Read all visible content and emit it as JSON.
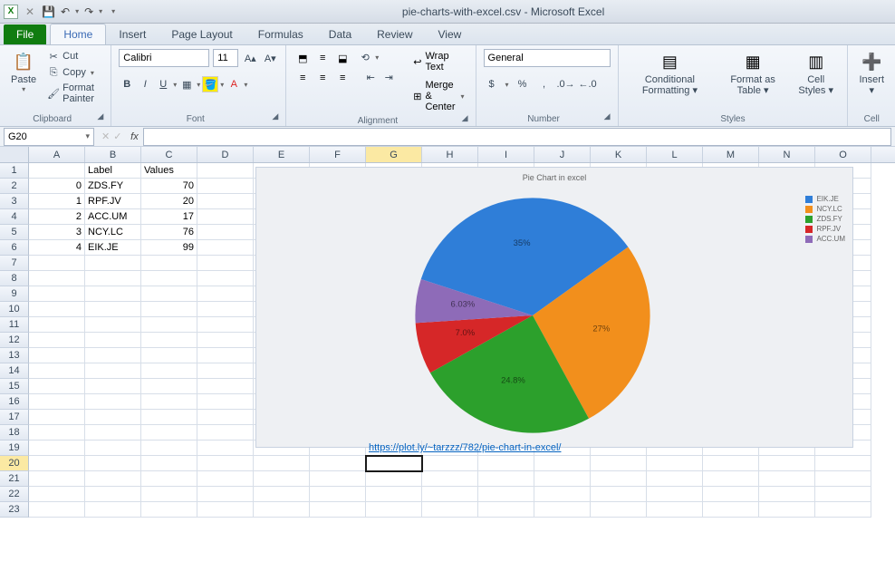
{
  "title": "pie-charts-with-excel.csv - Microsoft Excel",
  "qat": {
    "save": "💾",
    "undo": "↶",
    "redo": "↷"
  },
  "tabs": {
    "file": "File",
    "items": [
      "Home",
      "Insert",
      "Page Layout",
      "Formulas",
      "Data",
      "Review",
      "View"
    ],
    "active": "Home"
  },
  "ribbon": {
    "clipboard": {
      "title": "Clipboard",
      "paste": "Paste",
      "cut": "Cut",
      "copy": "Copy",
      "format_painter": "Format Painter"
    },
    "font": {
      "title": "Font",
      "name": "Calibri",
      "size": "11",
      "bold": "B",
      "italic": "I",
      "underline": "U"
    },
    "alignment": {
      "title": "Alignment",
      "wrap": "Wrap Text",
      "merge": "Merge & Center"
    },
    "number": {
      "title": "Number",
      "format": "General"
    },
    "styles": {
      "title": "Styles",
      "cond": "Conditional Formatting",
      "table": "Format as Table",
      "cell": "Cell Styles"
    },
    "cells": {
      "title": "Cell",
      "insert": "Insert"
    }
  },
  "name_box": "G20",
  "formula": "",
  "columns": [
    "A",
    "B",
    "C",
    "D",
    "E",
    "F",
    "G",
    "H",
    "I",
    "J",
    "K",
    "L",
    "M",
    "N",
    "O"
  ],
  "row_count": 23,
  "active_col": "G",
  "active_row": 20,
  "sheet": {
    "headers": {
      "B1": "Label",
      "C1": "Values"
    },
    "data": [
      {
        "a": 0,
        "b": "ZDS.FY",
        "c": 70
      },
      {
        "a": 1,
        "b": "RPF.JV",
        "c": 20
      },
      {
        "a": 2,
        "b": "ACC.UM",
        "c": 17
      },
      {
        "a": 3,
        "b": "NCY.LC",
        "c": 76
      },
      {
        "a": 4,
        "b": "EIK.JE",
        "c": 99
      }
    ],
    "link_cell": "G19",
    "link_text": "https://plot.ly/~tarzzz/782/pie-chart-in-excel/"
  },
  "chart_data": {
    "type": "pie",
    "title": "Pie Chart in excel",
    "series": [
      {
        "name": "EIK.JE",
        "value": 99,
        "pct": 35.11,
        "color": "#2f7ed8"
      },
      {
        "name": "NCY.LC",
        "value": 76,
        "pct": 26.95,
        "color": "#f28f1c"
      },
      {
        "name": "ZDS.FY",
        "value": 70,
        "pct": 24.82,
        "color": "#2ca02c"
      },
      {
        "name": "RPF.JV",
        "value": 20,
        "pct": 7.09,
        "color": "#d62728"
      },
      {
        "name": "ACC.UM",
        "value": 17,
        "pct": 6.03,
        "color": "#8e6bb8"
      }
    ],
    "legend_position": "right",
    "data_labels": [
      "35%",
      "27%",
      "24.8%",
      "7.0%",
      "6.03%"
    ]
  }
}
